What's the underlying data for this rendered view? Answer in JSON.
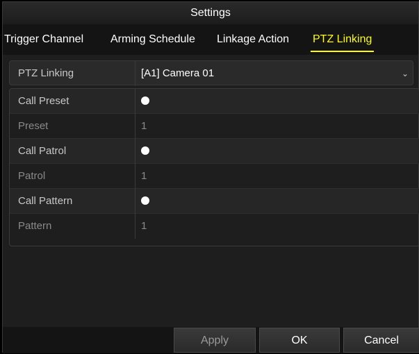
{
  "window": {
    "title": "Settings"
  },
  "tabs": [
    {
      "label": "Trigger Channel",
      "active": false
    },
    {
      "label": "Arming Schedule",
      "active": false
    },
    {
      "label": "Linkage Action",
      "active": false
    },
    {
      "label": "PTZ Linking",
      "active": true
    }
  ],
  "ptz_linking": {
    "label": "PTZ Linking",
    "value": "[A1] Camera 01"
  },
  "settings": {
    "call_preset": {
      "label": "Call Preset"
    },
    "preset": {
      "label": "Preset",
      "value": "1"
    },
    "call_patrol": {
      "label": "Call Patrol"
    },
    "patrol": {
      "label": "Patrol",
      "value": "1"
    },
    "call_pattern": {
      "label": "Call Pattern"
    },
    "pattern": {
      "label": "Pattern",
      "value": "1"
    }
  },
  "buttons": {
    "apply": "Apply",
    "ok": "OK",
    "cancel": "Cancel"
  },
  "colors": {
    "active_tab": "#ffff00",
    "background": "#1e1e1e"
  }
}
